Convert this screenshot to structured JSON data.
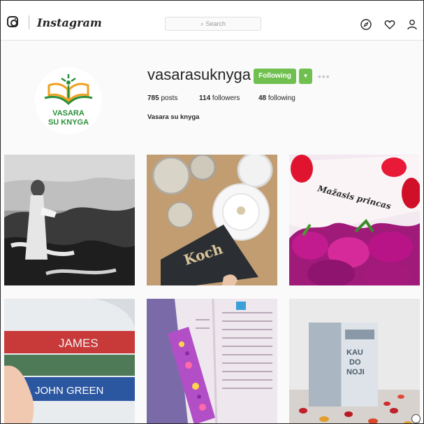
{
  "topbar": {
    "app_name": "Instagram",
    "search_placeholder": "Search",
    "icons": [
      "instagram-glyph-icon",
      "explore-compass-icon",
      "activity-heart-icon",
      "profile-person-icon"
    ]
  },
  "profile": {
    "logo_text_line1": "VASARA",
    "logo_text_line2": "SU KNYGA",
    "username": "vasarasuknyga",
    "follow_label": "Following",
    "more_label": "•••",
    "stats": {
      "posts_count": "785",
      "posts_label": "posts",
      "followers_count": "114",
      "followers_label": "followers",
      "following_count": "48",
      "following_label": "following"
    },
    "full_name": "Vasara su knyga"
  },
  "grid": {
    "posts": [
      {
        "id": "beach-reading-photo",
        "caption": ""
      },
      {
        "id": "koch-book-coffee-photo",
        "book_title": "Koch"
      },
      {
        "id": "tulips-book-photo",
        "book_title": "Mažasis princas"
      },
      {
        "id": "book-stack-photo",
        "spine_top": "JAMES",
        "spine_bottom": "JOHN GREEN"
      },
      {
        "id": "bookmark-open-book-photo",
        "caption": ""
      },
      {
        "id": "hardcover-rose-petals-photo",
        "book_title_line1": "KAU",
        "book_title_line2": "DO",
        "book_title_line3": "NOJI"
      }
    ]
  },
  "colors": {
    "accent_green": "#70c050",
    "logo_green": "#2b8f39",
    "logo_orange": "#f0a020",
    "text_primary": "#262626"
  }
}
